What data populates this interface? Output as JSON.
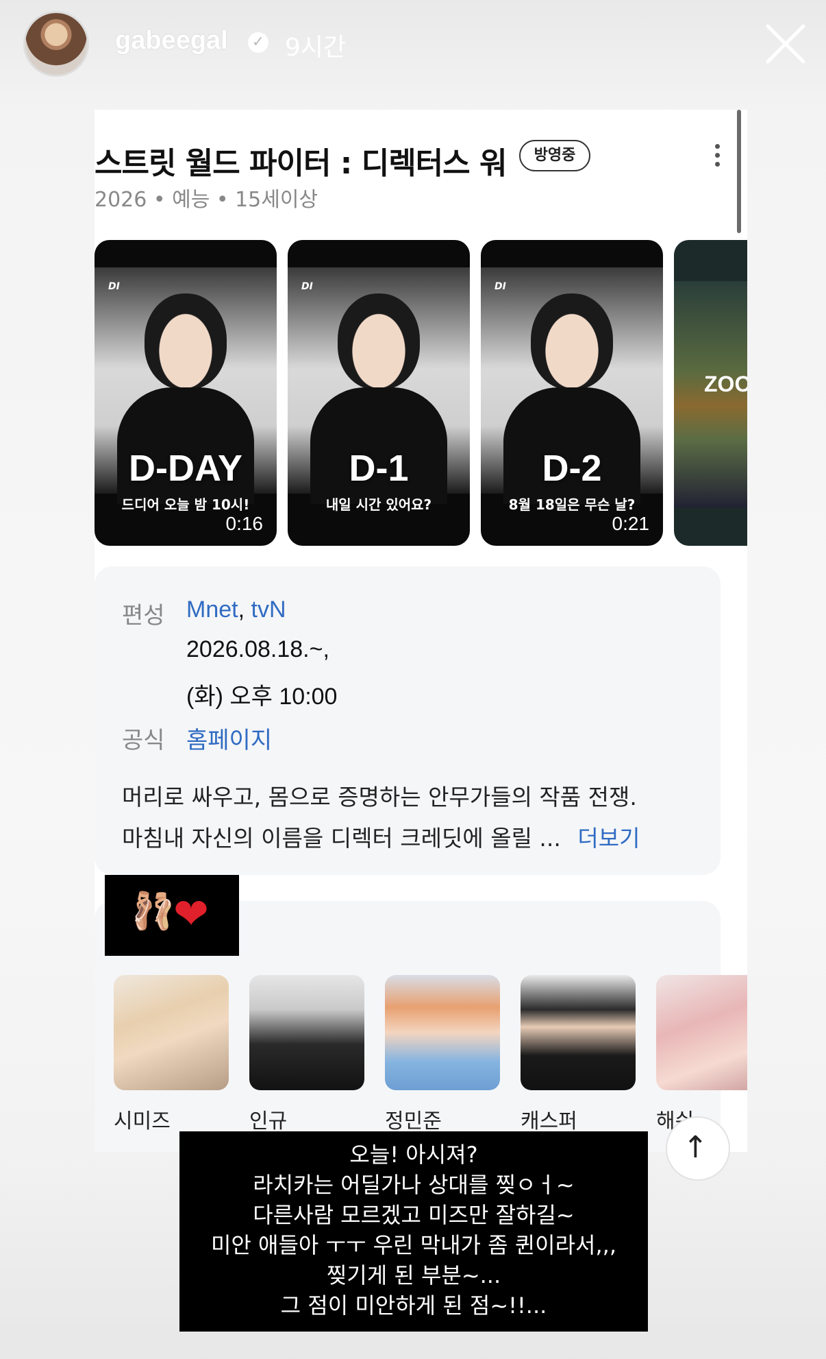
{
  "story": {
    "username": "gabeegal",
    "time_ago": "9시간"
  },
  "show": {
    "title": "스트릿 월드 파이터 : 디렉터스 워",
    "badge": "방영중",
    "meta": "2026 • 예능 • 15세이상"
  },
  "clips": [
    {
      "label": "D-DAY",
      "subtitle": "드디어 오늘 밤 10시!",
      "duration": "0:16"
    },
    {
      "label": "D-1",
      "subtitle": "내일 시간 있어요?",
      "duration": ""
    },
    {
      "label": "D-2",
      "subtitle": "8월 18일은 무슨 날?",
      "duration": "0:21"
    },
    {
      "label": "ZOO",
      "subtitle": "",
      "duration": ""
    }
  ],
  "info": {
    "broadcast_label": "편성",
    "channels": [
      "Mnet",
      "tvN"
    ],
    "channel_sep": ",",
    "date_line": "2026.08.18.~,",
    "time_line": "(화) 오후 10:00",
    "official_label": "공식",
    "official_link": "홈페이지",
    "description_1": "머리로 싸우고, 몸으로 증명하는 안무가들의 작품 전쟁.",
    "description_2": "마침내 자신의 이름을 디렉터 크레딧에 올릴 ...",
    "more": "더보기"
  },
  "cast": [
    {
      "name": "시미즈"
    },
    {
      "name": "인규"
    },
    {
      "name": "정민준"
    },
    {
      "name": "캐스퍼"
    },
    {
      "name": "해쉬"
    }
  ],
  "emoji": {
    "dancer": "🩰",
    "heart": "❤"
  },
  "caption": [
    "오늘! 아시져?",
    "라치카는 어딜가나 상대를 찢ㅇㅓ~",
    "다른사람 모르겠고 미즈만 잘하길~",
    "미안 애들아 ㅜㅜ 우린 막내가 좀 퀸이라서,,,",
    "찢기게 된 부분~...",
    "그 점이 미안하게 된 점~!!..."
  ],
  "colors": {
    "link": "#2f6bc2",
    "badge_border": "#333333",
    "heart": "#e0202a"
  }
}
